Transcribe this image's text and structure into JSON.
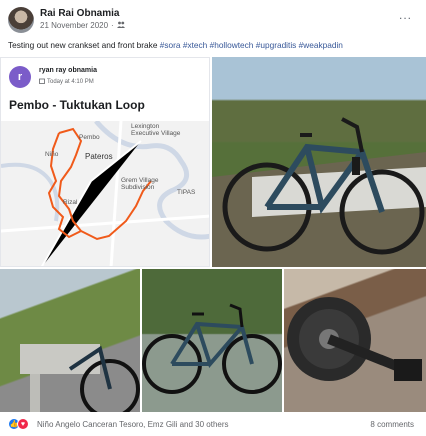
{
  "post": {
    "author": "Rai Rai Obnamia",
    "date": "21 November 2020",
    "audience_icon": "friends-icon",
    "more_label": "...",
    "caption_text": "Testing out new crankset and front brake",
    "hashtags": [
      "#sora",
      "#xtech",
      "#hollowtech",
      "#upgraditis",
      "#weakpadin"
    ]
  },
  "map_card": {
    "avatar_letter": "r",
    "user": "ryan ray obnamia",
    "time": "Today at 4:10 PM",
    "title": "Pembo - Tuktukan Loop",
    "labels": {
      "lexington": "Lexington\nExecutive Village",
      "pembo": "Pembo",
      "nino": "Niño",
      "pateros": "Pateros",
      "grem": "Grem Village\nSubdivision",
      "rizal": "Rizal",
      "tipas": "TIPAS"
    },
    "route_color": "#f05a1a"
  },
  "photos": [
    {
      "name": "bike-photo-1"
    },
    {
      "name": "bike-photo-2"
    },
    {
      "name": "bike-photo-3"
    },
    {
      "name": "crankset-photo"
    }
  ],
  "footer": {
    "reactors": "Niño Angelo Canceran Tesoro, Emz Gili and 30 others",
    "comments": "8 comments"
  }
}
